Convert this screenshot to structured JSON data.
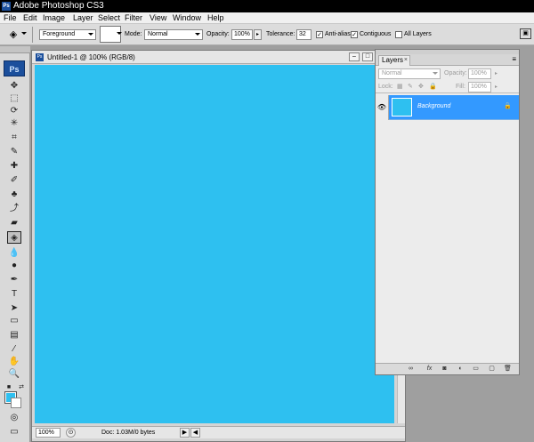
{
  "window": {
    "app_badge": "Ps",
    "title": "Adobe Photoshop CS3"
  },
  "menu": [
    "File",
    "Edit",
    "Image",
    "Layer",
    "Select",
    "Filter",
    "View",
    "Window",
    "Help"
  ],
  "options": {
    "fill_source": "Foreground",
    "mode_label": "Mode:",
    "mode_value": "Normal",
    "opacity_label": "Opacity:",
    "opacity_value": "100%",
    "tolerance_label": "Tolerance:",
    "tolerance_value": "32",
    "anti_alias_label": "Anti-alias",
    "anti_alias_checked": true,
    "contiguous_label": "Contiguous",
    "contiguous_checked": true,
    "all_layers_label": "All Layers",
    "all_layers_checked": false
  },
  "toolbox": {
    "logo": "Ps",
    "tools": [
      {
        "name": "move-tool",
        "glyph": "✥"
      },
      {
        "name": "marquee-tool",
        "glyph": "⬚"
      },
      {
        "name": "lasso-tool",
        "glyph": "⟳"
      },
      {
        "name": "magic-wand-tool",
        "glyph": "✳"
      },
      {
        "name": "crop-tool",
        "glyph": "⌗"
      },
      {
        "name": "slice-tool",
        "glyph": "✎"
      },
      {
        "name": "healing-brush-tool",
        "glyph": "✚"
      },
      {
        "name": "brush-tool",
        "glyph": "✐"
      },
      {
        "name": "clone-stamp-tool",
        "glyph": "♣"
      },
      {
        "name": "history-brush-tool",
        "glyph": "⤴"
      },
      {
        "name": "eraser-tool",
        "glyph": "▰"
      },
      {
        "name": "paint-bucket-tool",
        "glyph": "◈",
        "active": true
      },
      {
        "name": "blur-tool",
        "glyph": "💧"
      },
      {
        "name": "dodge-tool",
        "glyph": "●"
      },
      {
        "name": "pen-tool",
        "glyph": "✒"
      },
      {
        "name": "type-tool",
        "glyph": "T"
      },
      {
        "name": "path-selection-tool",
        "glyph": "➤"
      },
      {
        "name": "shape-tool",
        "glyph": "▭"
      },
      {
        "name": "notes-tool",
        "glyph": "▤"
      },
      {
        "name": "eyedropper-tool",
        "glyph": "⁄"
      },
      {
        "name": "hand-tool",
        "glyph": "✋"
      },
      {
        "name": "zoom-tool",
        "glyph": "🔍"
      }
    ],
    "foreground_color": "#2ec0f0",
    "background_color": "#ffffff"
  },
  "document": {
    "title": "Untitled-1 @ 100% (RGB/8)",
    "canvas_color": "#2ec0f0",
    "zoom": "100%",
    "info": "Doc: 1.03M/0 bytes"
  },
  "layers_panel": {
    "tab": "Layers",
    "blend_mode": "Normal",
    "opacity_label": "Opacity:",
    "opacity_value": "100%",
    "lock_label": "Lock:",
    "fill_label": "Fill:",
    "fill_value": "100%",
    "layers": [
      {
        "name": "Background",
        "visible": true,
        "locked": true,
        "selected": true,
        "thumb_color": "#2ec0f0"
      }
    ]
  },
  "colors": {
    "accent_selection": "#3399ff",
    "canvas": "#2ec0f0"
  }
}
